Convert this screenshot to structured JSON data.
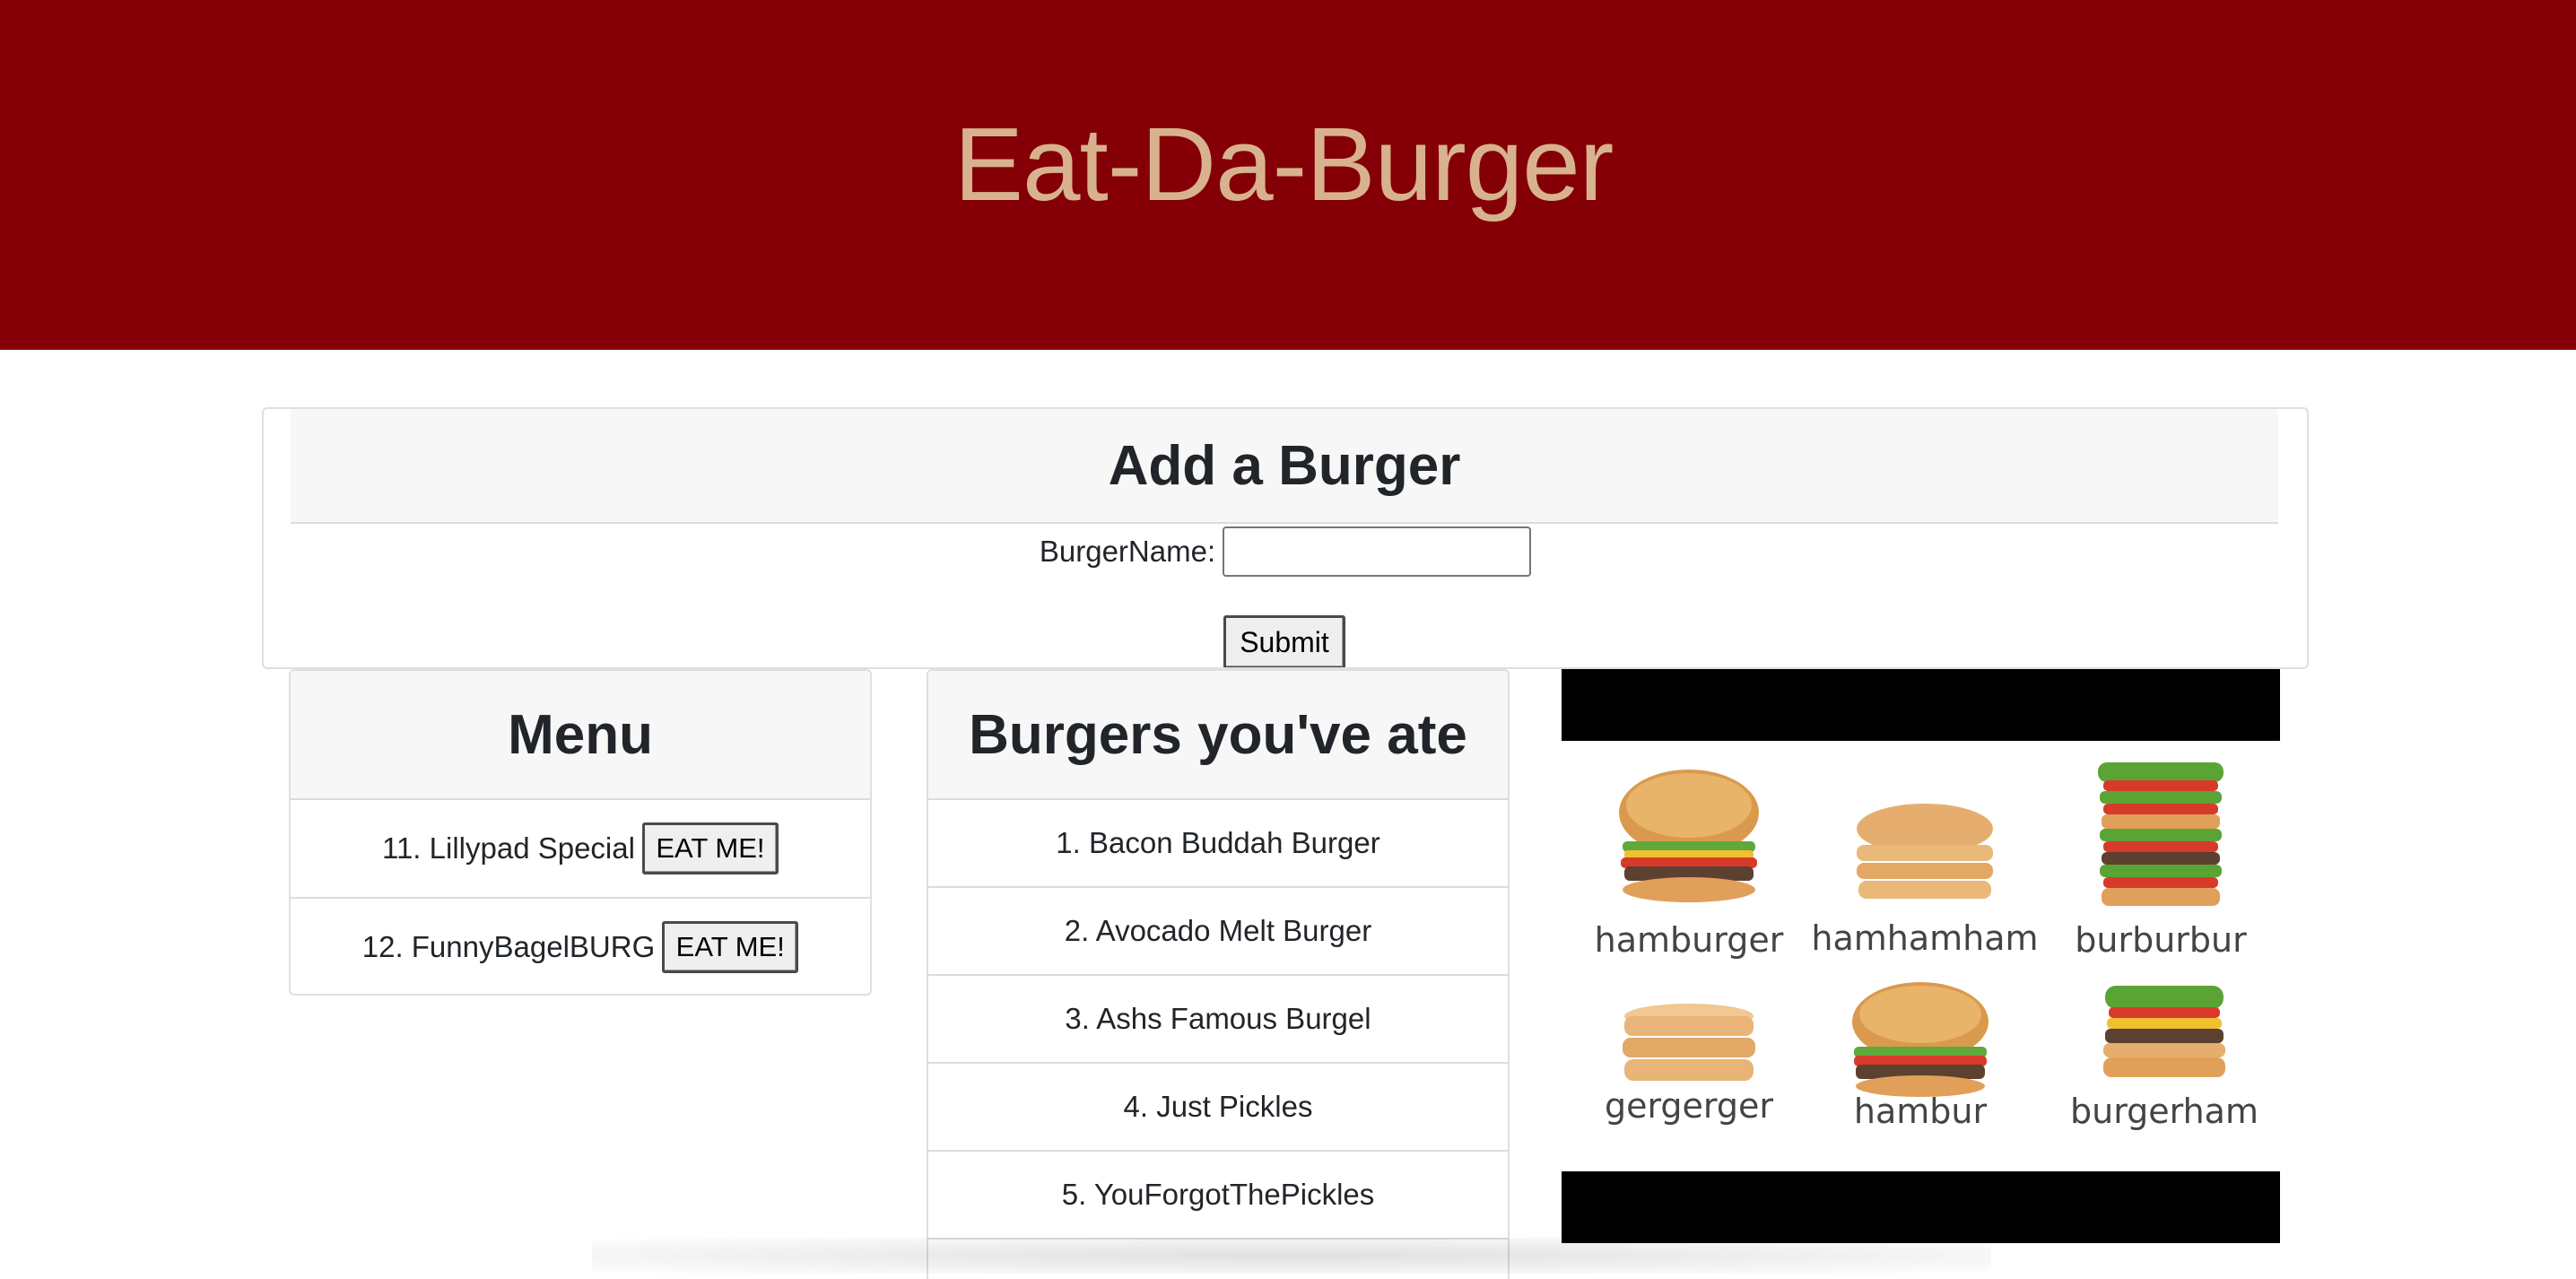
{
  "hero": {
    "title": "Eat-Da-Burger"
  },
  "add_form": {
    "heading": "Add a Burger",
    "name_label": "BurgerName:",
    "name_value": "",
    "submit_label": "Submit"
  },
  "menu": {
    "heading": "Menu",
    "items": [
      {
        "label": "11. Lillypad Special",
        "button": "EAT ME!"
      },
      {
        "label": "12. FunnyBagelBURG",
        "button": "EAT ME!"
      }
    ]
  },
  "eaten": {
    "heading": "Burgers you've ate",
    "items": [
      "1. Bacon Buddah Burger",
      "2. Avocado Melt Burger",
      "3. Ashs Famous Burgel",
      "4. Just Pickles",
      "5. YouForgotThePickles"
    ]
  },
  "burger_image": {
    "captions": [
      "hamburger",
      "hamhamham",
      "burburbur",
      "gergerger",
      "hambur",
      "burgerham"
    ]
  },
  "colors": {
    "hero_bg": "#840006",
    "hero_text": "#d8b28e"
  }
}
